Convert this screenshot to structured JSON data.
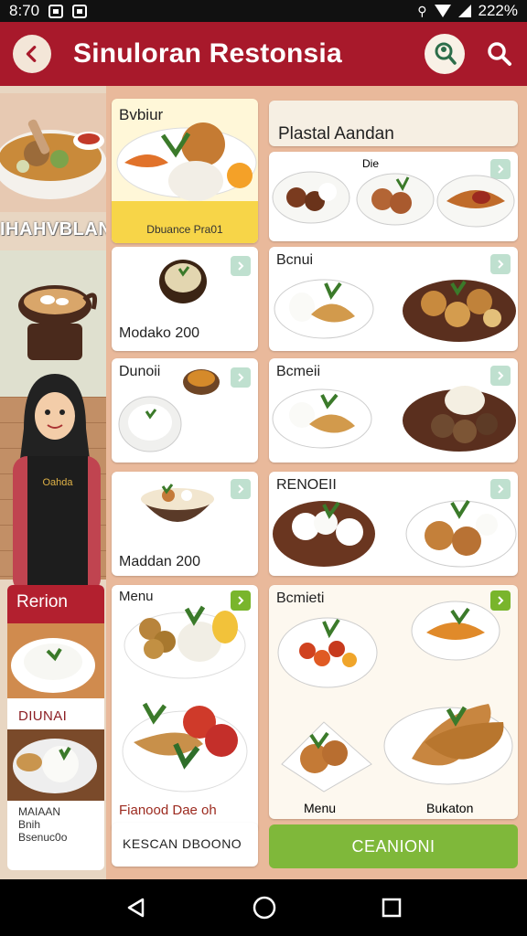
{
  "status_bar": {
    "time": "8:70",
    "battery": "222%"
  },
  "app_bar": {
    "title": "Sinuloran Restonsia"
  },
  "left_panel": {
    "heading": "IHAHVBLAN",
    "card_header": "Rerion",
    "card_label": "DIUNAI",
    "card_footer_line1": "MAIAAN",
    "card_footer_line2": "Bnih",
    "card_footer_line3": "Bsenuc0o"
  },
  "grid": {
    "mid": [
      {
        "title": "Bvbiur",
        "caption": "Dbuance Pra01"
      },
      {
        "title": "",
        "caption": "Modako 200"
      },
      {
        "title": "Dunoii",
        "caption": ""
      },
      {
        "title": "",
        "caption": "Maddan 200"
      },
      {
        "title": "Menu",
        "caption": "Fianood Dae oh"
      },
      {
        "title": "",
        "caption": "KESCAN DBOONO"
      }
    ],
    "right": [
      {
        "title": "Plastal Aandan",
        "caption": ""
      },
      {
        "title": "",
        "caption": "Die"
      },
      {
        "title": "Bcnui",
        "caption": ""
      },
      {
        "title": "Bcmeii",
        "caption": ""
      },
      {
        "title": "RENOEII",
        "caption": ""
      },
      {
        "title": "Bcmieti",
        "caption": ""
      }
    ],
    "right_bottom_labels": [
      "Menu",
      "Bukaton"
    ],
    "action_button": "CEANIONI"
  },
  "colors": {
    "brand": "#a8192b",
    "accent_green": "#79b52c",
    "badge_teal": "#bfe0cf"
  }
}
